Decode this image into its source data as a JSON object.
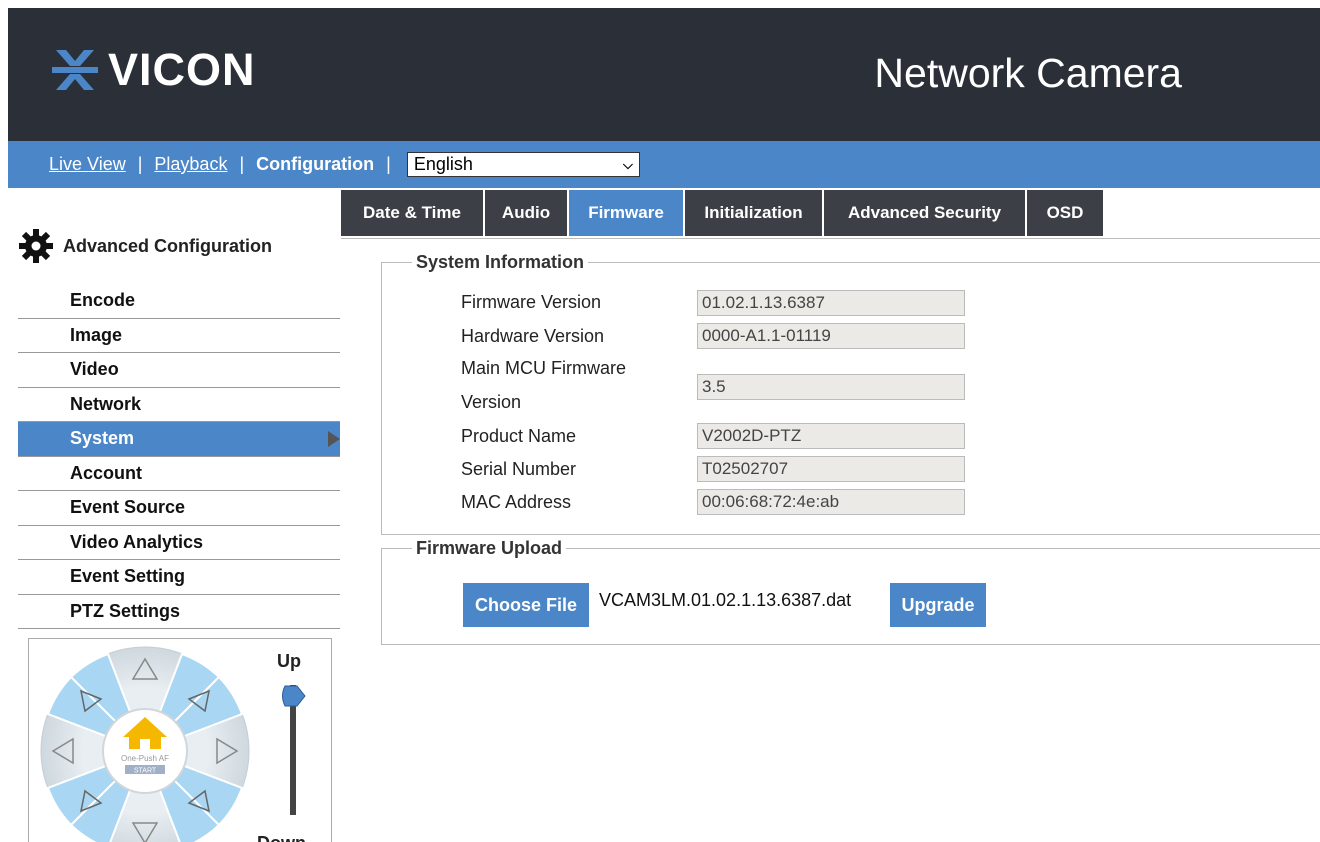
{
  "header": {
    "brand": "VICON",
    "product_title": "Network Camera"
  },
  "nav": {
    "live_view": "Live View",
    "playback": "Playback",
    "configuration": "Configuration",
    "separator": "|",
    "language": "English"
  },
  "sidebar": {
    "title": "Advanced Configuration",
    "items": [
      {
        "label": "Encode"
      },
      {
        "label": "Image"
      },
      {
        "label": "Video"
      },
      {
        "label": "Network"
      },
      {
        "label": "System"
      },
      {
        "label": "Account"
      },
      {
        "label": "Event Source"
      },
      {
        "label": "Video Analytics"
      },
      {
        "label": "Event Setting"
      },
      {
        "label": "PTZ Settings"
      }
    ],
    "active_item": "System"
  },
  "ptz": {
    "up_label": "Up",
    "down_label": "Down",
    "center_text": "One-Push AF",
    "start_text": "START"
  },
  "tabs": {
    "items": [
      "Date & Time",
      "Audio",
      "Firmware",
      "Initialization",
      "Advanced Security",
      "OSD"
    ],
    "active": "Firmware"
  },
  "system_info": {
    "legend": "System Information",
    "firmware_version_label": "Firmware Version",
    "firmware_version": "01.02.1.13.6387",
    "hardware_version_label": "Hardware Version",
    "hardware_version": "0000-A1.1-01119",
    "mcu_label_line1": "Main MCU Firmware",
    "mcu_label_line2": "Version",
    "mcu_version": "3.5",
    "product_name_label": "Product Name",
    "product_name": "V2002D-PTZ",
    "serial_label": "Serial Number",
    "serial": "T02502707",
    "mac_label": "MAC Address",
    "mac": "00:06:68:72:4e:ab"
  },
  "firmware_upload": {
    "legend": "Firmware Upload",
    "choose_file": "Choose File",
    "file_name": "VCAM3LM.01.02.1.13.6387.dat",
    "upgrade": "Upgrade"
  },
  "colors": {
    "header_bg": "#2b2f38",
    "accent": "#4a86c8",
    "tab_bg": "#3c3f46"
  }
}
